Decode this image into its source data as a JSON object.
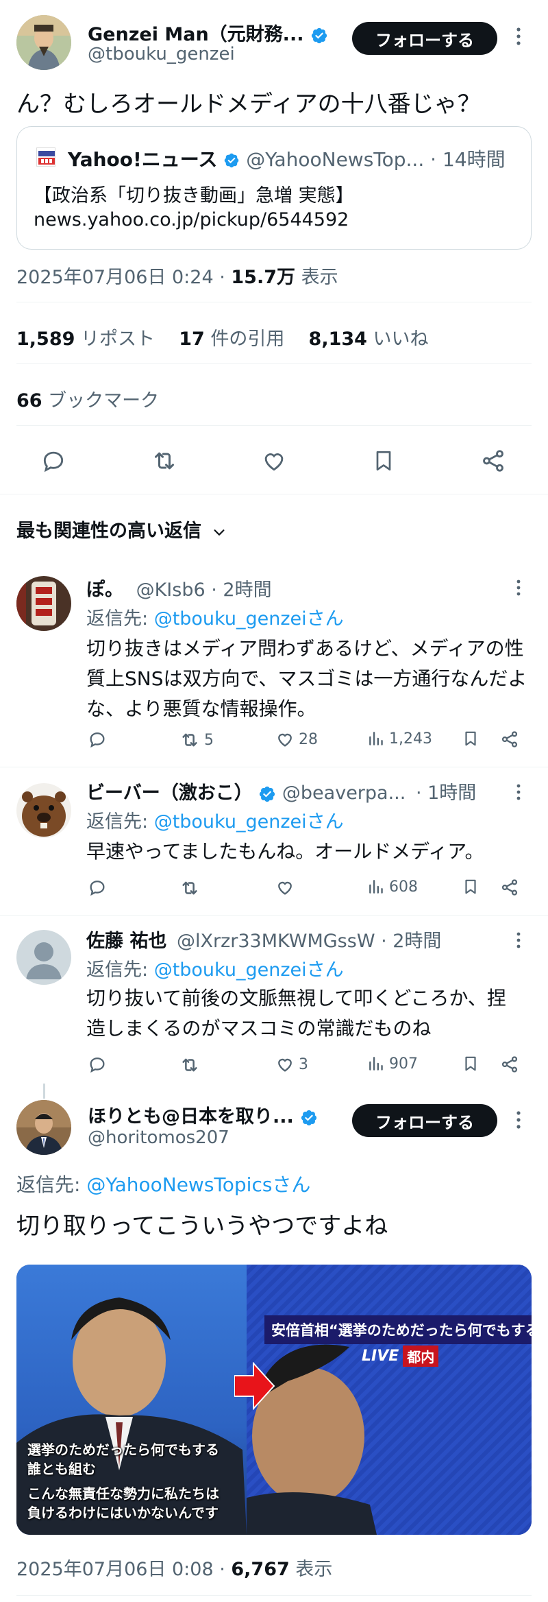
{
  "main_tweet": {
    "author_name": "Genzei Man（元財務...",
    "author_handle": "@tbouku_genzei",
    "follow_label": "フォローする",
    "text": "ん？むしろオールドメディアの十八番じゃ？",
    "quote": {
      "source_name": "Yahoo!ニュース",
      "source_handle": "@YahooNewsTop...",
      "time": "· 14時間",
      "title": "【政治系「切り抜き動画」急増 実態】",
      "url": "news.yahoo.co.jp/pickup/6544592",
      "logo_text": "YAHOO!"
    },
    "datetime": "2025年07月06日 0:24 · ",
    "views": "15.7万",
    "views_label": " 表示",
    "stats": {
      "reposts": "1,589",
      "reposts_label": " リポスト",
      "quotes": "17",
      "quotes_label": " 件の引用",
      "likes": "8,134",
      "likes_label": " いいね",
      "bookmarks": "66",
      "bookmarks_label": " ブックマーク"
    }
  },
  "replies_header": "最も関連性の高い返信",
  "replies": [
    {
      "name": "ぽ。",
      "handle": "@KIsb6 · 2時間",
      "reply_to_prefix": "返信先: ",
      "reply_to": "@tbouku_genzeiさん",
      "text": "切り抜きはメディア問わずあるけど、メディアの性質上SNSは双方向で、マスゴミは一方通行なんだよな、より悪質な情報操作。",
      "retweets": "5",
      "likes": "28",
      "views": "1,243"
    },
    {
      "name": "ビーバー（激おこ）",
      "handle": "@beaverpa...",
      "time": "· 1時間",
      "reply_to_prefix": "返信先: ",
      "reply_to": "@tbouku_genzeiさん",
      "text": "早速やってましたもんね。オールドメディア。",
      "retweets": "",
      "likes": "",
      "views": "608"
    },
    {
      "name": "佐藤 祐也",
      "handle": "@lXrzr33MKWMGssW · 2時間",
      "reply_to_prefix": "返信先: ",
      "reply_to": "@tbouku_genzeiさん",
      "text": "切り抜いて前後の文脈無視して叩くどころか、捏造しまくるのがマスコミの常識だものね",
      "retweets": "",
      "likes": "3",
      "views": "907"
    }
  ],
  "focus_tweet": {
    "author_name": "ほりとも@日本を取り...",
    "author_handle": "@horitomos207",
    "follow_label": "フォローする",
    "reply_to_prefix": "返信先: ",
    "reply_to": "@YahooNewsTopicsさん",
    "text": "切り取りってこういうやつですよね",
    "image": {
      "caption_left_1": "選挙のためだったら何でもする",
      "caption_left_2": "誰とも組む",
      "caption_left_3": "こんな無責任な勢力に私たちは",
      "caption_left_4": "負けるわけにはいかないんです",
      "banner_right": "安倍首相“選挙のためだったら何でもする”",
      "live_label": "LIVE",
      "live_location": "都内"
    },
    "datetime": "2025年07月06日 0:08 · ",
    "views": "6,767",
    "views_label": " 表示"
  },
  "colors": {
    "accent": "#1d9bf0",
    "text": "#0f1419",
    "muted": "#536471",
    "divider": "#eff3f4"
  }
}
